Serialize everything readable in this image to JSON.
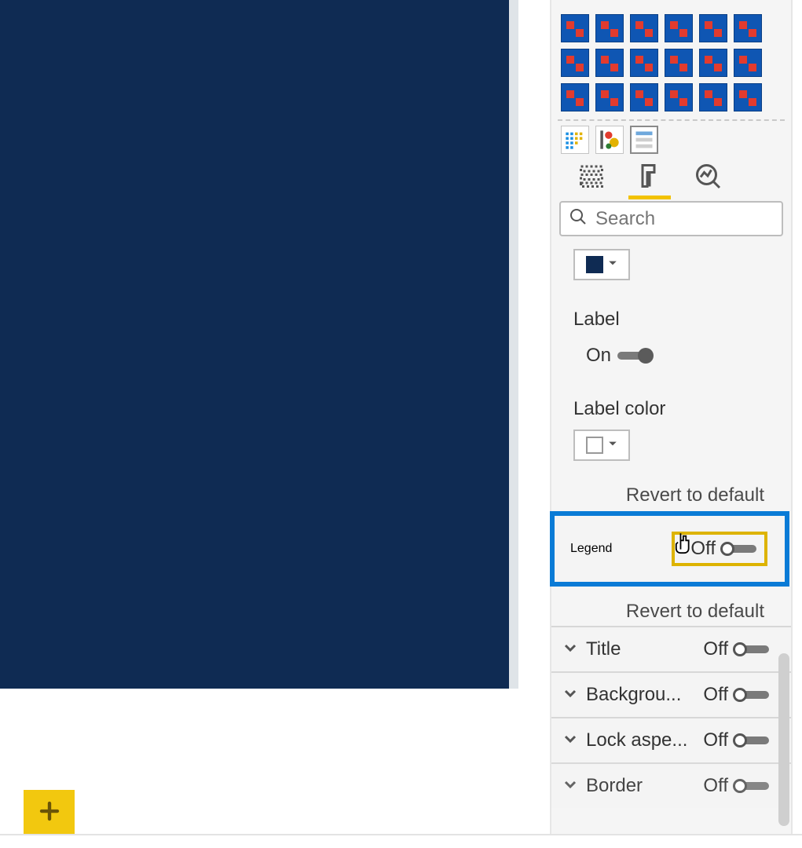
{
  "search": {
    "placeholder": "Search"
  },
  "colorSwatch1": "#0f2b53",
  "labelHeading": "Label",
  "labelToggle": {
    "state": "On"
  },
  "labelColorHeading": "Label color",
  "labelColorSwatch": "#ffffff",
  "revertText": "Revert to default",
  "legend": {
    "name": "Legend",
    "toggleState": "Off"
  },
  "revertText2": "Revert to default",
  "sections": [
    {
      "name": "Title",
      "state": "Off"
    },
    {
      "name": "Backgrou...",
      "state": "Off"
    },
    {
      "name": "Lock aspe...",
      "state": "Off"
    },
    {
      "name": "Border",
      "state": "Off"
    }
  ],
  "icons": {
    "plus": "plus-icon",
    "search": "search-icon",
    "fields": "fields-tab-icon",
    "format": "format-tab-icon",
    "analytics": "analytics-tab-icon",
    "chevDown": "chevron-down-icon",
    "chevUp": "chevron-up-icon"
  }
}
